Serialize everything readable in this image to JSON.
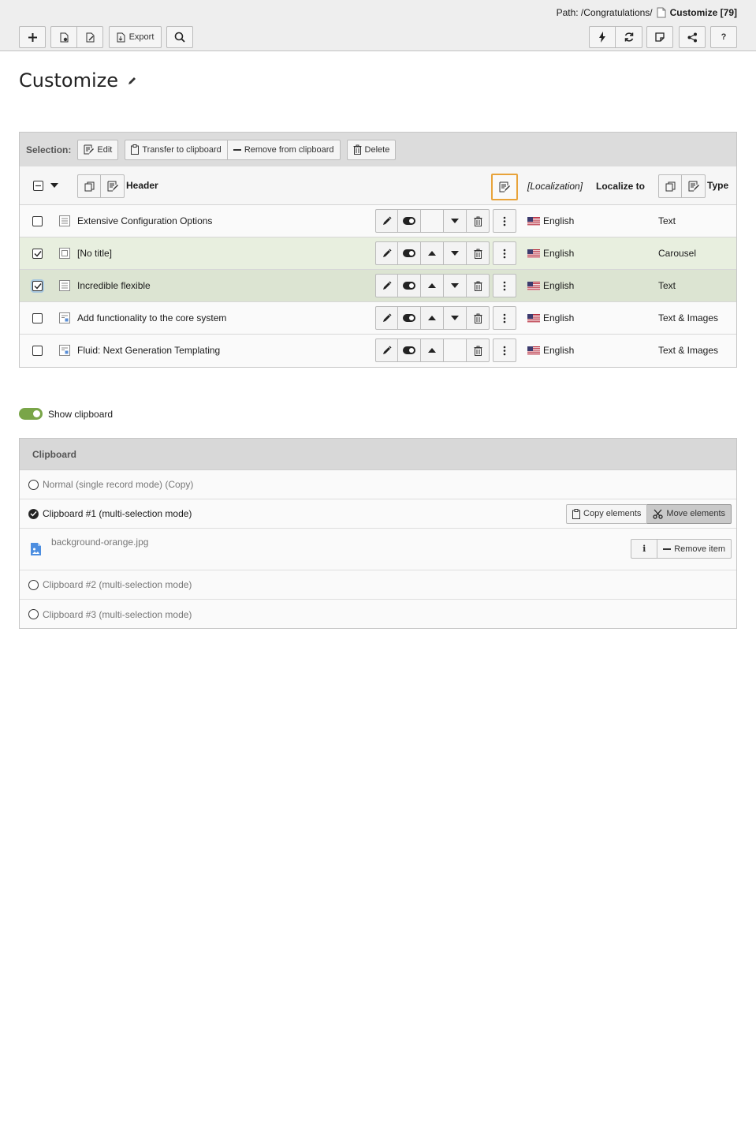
{
  "header": {
    "path_label": "Path: /Congratulations/",
    "current_page": "Customize [79]"
  },
  "toolbar": {
    "export_label": "Export",
    "help_label": "?"
  },
  "page": {
    "title": "Customize"
  },
  "selection": {
    "label": "Selection:",
    "edit": "Edit",
    "transfer": "Transfer to clipboard",
    "remove": "Remove from clipboard",
    "delete": "Delete"
  },
  "table": {
    "columns": {
      "header": "Header",
      "localization": "[Localization]",
      "localize_to": "Localize to",
      "type": "Type"
    },
    "rows": [
      {
        "title": "Extensive Configuration Options",
        "language": "English",
        "type": "Text",
        "checked": false
      },
      {
        "title": "[No title]",
        "language": "English",
        "type": "Carousel",
        "checked": true
      },
      {
        "title": "Incredible flexible",
        "language": "English",
        "type": "Text",
        "checked": true
      },
      {
        "title": "Add functionality to the core system",
        "language": "English",
        "type": "Text & Images",
        "checked": false
      },
      {
        "title": "Fluid: Next Generation Templating",
        "language": "English",
        "type": "Text & Images",
        "checked": false
      }
    ]
  },
  "clipboard_toggle": {
    "label": "Show clipboard",
    "on": true
  },
  "clipboard": {
    "title": "Clipboard",
    "normal": "Normal (single record mode) (Copy)",
    "pad1": "Clipboard #1 (multi-selection mode)",
    "copy_elements": "Copy elements",
    "move_elements": "Move elements",
    "item_name": "background-orange.jpg",
    "info_label": "i",
    "remove_item": "Remove item",
    "pad2": "Clipboard #2 (multi-selection mode)",
    "pad3": "Clipboard #3 (multi-selection mode)"
  },
  "colors": {
    "accent_green": "#79a548",
    "focus_orange": "#e8a33a",
    "selected_row": "#e8efdf",
    "selected_row_dark": "#dce4d2"
  }
}
